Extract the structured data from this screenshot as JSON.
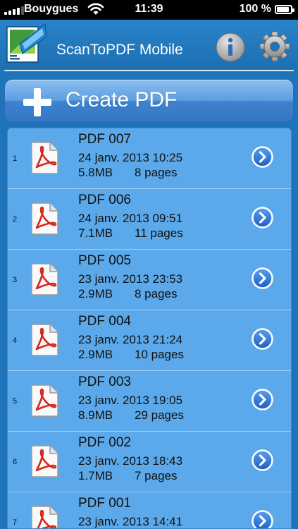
{
  "status_bar": {
    "carrier": "Bouygues",
    "time": "11:39",
    "battery": "100 %"
  },
  "header": {
    "title": "ScanToPDF Mobile",
    "icons": [
      "app-logo",
      "info-icon",
      "settings-gear-icon"
    ]
  },
  "create_button": {
    "label": "Create PDF",
    "icon": "plus-icon"
  },
  "colors": {
    "background": "#1f73b8",
    "list_row": "#5ba9ea",
    "button_accent": "#5e9fe0",
    "pdf_red": "#d9261c"
  },
  "documents": [
    {
      "index": "1",
      "name": "PDF 007",
      "date": "24 janv. 2013 10:25",
      "size": "5.8MB",
      "pages": "8 pages"
    },
    {
      "index": "2",
      "name": "PDF 006",
      "date": "24 janv. 2013 09:51",
      "size": "7.1MB",
      "pages": "11 pages"
    },
    {
      "index": "3",
      "name": "PDF 005",
      "date": "23 janv. 2013 23:53",
      "size": "2.9MB",
      "pages": "8 pages"
    },
    {
      "index": "4",
      "name": "PDF 004",
      "date": "23 janv. 2013 21:24",
      "size": "2.9MB",
      "pages": "10 pages"
    },
    {
      "index": "5",
      "name": "PDF 003",
      "date": "23 janv. 2013 19:05",
      "size": "8.9MB",
      "pages": "29 pages"
    },
    {
      "index": "6",
      "name": "PDF 002",
      "date": "23 janv. 2013 18:43",
      "size": "1.7MB",
      "pages": "7 pages"
    },
    {
      "index": "7",
      "name": "PDF 001",
      "date": "23 janv. 2013 14:41",
      "size": "",
      "pages": ""
    }
  ]
}
